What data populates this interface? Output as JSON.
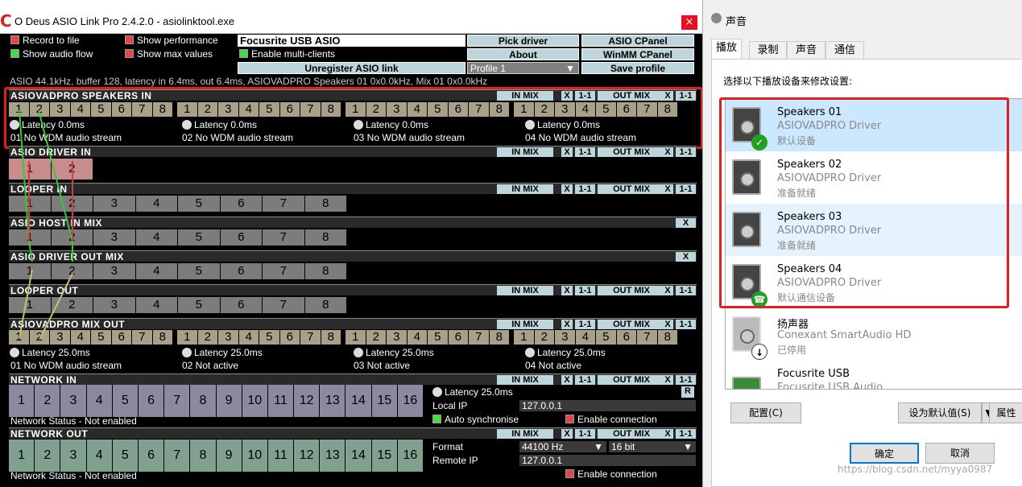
{
  "asio": {
    "title": "O Deus ASIO Link Pro 2.4.2.0 - asiolinktool.exe",
    "close": "×",
    "opts": {
      "record": "Record to file",
      "show_perf": "Show performance",
      "show_flow": "Show audio flow",
      "show_max": "Show max values",
      "multi": "Enable multi-clients"
    },
    "device": "Focusrite USB ASIO",
    "buttons": {
      "pick": "Pick driver",
      "asio_cpanel": "ASIO CPanel",
      "about": "About",
      "winmm": "WinMM CPanel",
      "unregister": "Unregister ASIO link",
      "save": "Save profile"
    },
    "profile": "Profile 1",
    "status": "ASIO 44.1kHz, buffer 128, latency in 6.4ms, out 6.4ms, ASIOVADPRO Speakers 01 0x0.0kHz, Mix 01 0x0.0kHz",
    "sections": {
      "spk_in": "ASIOVADPRO SPEAKERS IN",
      "drv_in": "ASIO DRIVER IN",
      "loop_in": "LOOPER IN",
      "host_mix": "ASIO HOST IN MIX",
      "drv_out": "ASIO DRIVER OUT MIX",
      "loop_out": "LOOPER OUT",
      "mix_out": "ASIOVADPRO MIX OUT",
      "net_in": "NETWORK IN",
      "net_out": "NETWORK OUT"
    },
    "sbtn": {
      "in_mix": "IN MIX",
      "x": "X",
      "one": "1-1",
      "out_mix": "OUT MIX",
      "r": "R"
    },
    "lat_in": [
      "Latency 0.0ms",
      "Latency 0.0ms",
      "Latency 0.0ms",
      "Latency 0.0ms"
    ],
    "wdm_in": [
      "01 No WDM audio stream",
      "02 No WDM audio stream",
      "03 No WDM audio stream",
      "04 No WDM audio stream"
    ],
    "lat_out": [
      "Latency 25.0ms",
      "Latency 25.0ms",
      "Latency 25.0ms",
      "Latency 25.0ms"
    ],
    "wdm_out": [
      "01 No WDM audio stream",
      "02 Not active",
      "03 Not active",
      "04 Not active"
    ],
    "net": {
      "lat": "Latency 25.0ms",
      "local_ip_label": "Local IP",
      "local_ip": "127.0.0.1",
      "auto_sync": "Auto synchronise",
      "enable_conn": "Enable connection",
      "status_in": "Network Status - Not enabled",
      "status_out": "Network Status - Not enabled",
      "format_label": "Format",
      "format": "44100 Hz",
      "bits": "16 bit",
      "remote_label": "Remote IP",
      "remote_ip": "127.0.0.1",
      "enable_conn2": "Enable connection"
    }
  },
  "sound": {
    "title": "声音",
    "tabs": [
      "播放",
      "录制",
      "声音",
      "通信"
    ],
    "hint": "选择以下播放设备来修改设置:",
    "devices": [
      {
        "name": "Speakers 01",
        "driver": "ASIOVADPRO Driver",
        "status": "默认设备"
      },
      {
        "name": "Speakers 02",
        "driver": "ASIOVADPRO Driver",
        "status": "准备就绪"
      },
      {
        "name": "Speakers 03",
        "driver": "ASIOVADPRO Driver",
        "status": "准备就绪"
      },
      {
        "name": "Speakers 04",
        "driver": "ASIOVADPRO Driver",
        "status": "默认通信设备"
      },
      {
        "name": "扬声器",
        "driver": "Conexant SmartAudio HD",
        "status": "已停用"
      },
      {
        "name": "Focusrite USB",
        "driver": "Focusrite USB Audio",
        "status": ""
      }
    ],
    "buttons": {
      "config": "配置(C)",
      "set_default": "设为默认值(S)",
      "props": "属性",
      "ok": "确定",
      "cancel": "取消"
    },
    "watermark": "https://blog.csdn.net/myya0987"
  }
}
